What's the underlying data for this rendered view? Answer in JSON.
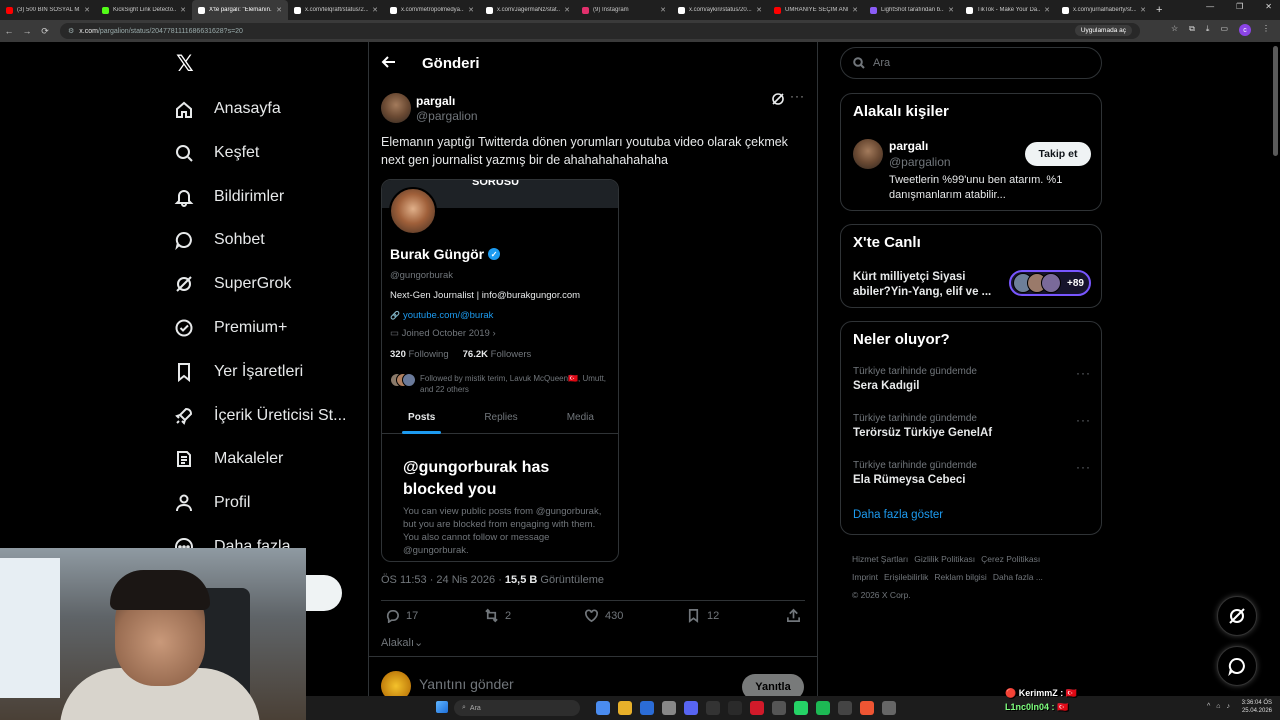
{
  "browser": {
    "tabs": [
      {
        "title": "(3) 500 BİN SOSYAL M...",
        "color": "#ff0000",
        "active": false
      },
      {
        "title": "KickSight Link Detecto...",
        "color": "#53fc18",
        "active": false
      },
      {
        "title": "X'te pargalı: \"Elemanın...",
        "color": "#ffffff",
        "active": true
      },
      {
        "title": "x.com/telqraft/status/2...",
        "color": "#ffffff",
        "active": false
      },
      {
        "title": "x.com/metropolmedya...",
        "color": "#ffffff",
        "active": false
      },
      {
        "title": "x.com/JagermaNz/stat...",
        "color": "#ffffff",
        "active": false
      },
      {
        "title": "(9) Instagram",
        "color": "#e1306c",
        "active": false
      },
      {
        "title": "x.com/aykiri/status/20...",
        "color": "#ffffff",
        "active": false
      },
      {
        "title": "ÜMRANİYE SEÇİM ANK...",
        "color": "#ff0000",
        "active": false
      },
      {
        "title": "LightShot tarafından b...",
        "color": "#8a5cf6",
        "active": false
      },
      {
        "title": "TikTok - Make Your Da...",
        "color": "#ffffff",
        "active": false
      },
      {
        "title": "x.com/jurnalhaberty/st...",
        "color": "#ffffff",
        "active": false
      }
    ],
    "url_host": "x.com",
    "url_path": "/pargalion/status/2047781111686631628?s=20",
    "open_in_app": "Uygulamada aç"
  },
  "nav": {
    "logo": "𝕏",
    "items": [
      {
        "label": "Anasayfa",
        "icon": "home-icon"
      },
      {
        "label": "Keşfet",
        "icon": "search-icon"
      },
      {
        "label": "Bildirimler",
        "icon": "bell-icon"
      },
      {
        "label": "Sohbet",
        "icon": "chat-icon"
      },
      {
        "label": "SuperGrok",
        "icon": "grok-icon"
      },
      {
        "label": "Premium+",
        "icon": "verified-icon"
      },
      {
        "label": "Yer İşaretleri",
        "icon": "bookmark-icon"
      },
      {
        "label": "İçerik Üreticisi St...",
        "icon": "rocket-icon"
      },
      {
        "label": "Makaleler",
        "icon": "article-icon"
      },
      {
        "label": "Profil",
        "icon": "person-icon"
      },
      {
        "label": "Daha fazla",
        "icon": "more-circle-icon"
      }
    ]
  },
  "post": {
    "header_title": "Gönderi",
    "author_name": "pargalı",
    "author_handle": "@pargalion",
    "text": "Elemanın yaptığı Twitterda dönen yorumları youtuba video olarak çekmek next gen journalist yazmış bir de ahahahahahahaha",
    "meta_time": "ÖS 11:53 · 24 Nis 2026 · ",
    "meta_views": "15,5 B",
    "meta_views_label": " Görüntüleme",
    "counts": {
      "replies": "17",
      "reposts": "2",
      "likes": "430",
      "bookmarks": "12"
    },
    "relevant_label": "Alakalı",
    "reply_placeholder": "Yanıtını gönder",
    "reply_button": "Yanıtla"
  },
  "embedded": {
    "top_text": "SORUSU",
    "name": "Burak Güngör",
    "handle": "@gungorburak",
    "bio": "Next-Gen Journalist | info@burakgungor.com",
    "link": "youtube.com/@burak",
    "joined": "Joined October 2019",
    "following_count": "320",
    "following_label": " Following",
    "followers_count": "76.2K",
    "followers_label": " Followers",
    "followed_by": "Followed by mistik terim, Lavuk McQueen🇹🇷, Umutt, and 22 others",
    "tabs": [
      "Posts",
      "Replies",
      "Media"
    ],
    "blocked_title": "@gungorburak has blocked you",
    "blocked_body": "You can view public posts from @gungorburak, but you are blocked from engaging with them. You also cannot follow or message @gungorburak."
  },
  "right": {
    "search_placeholder": "Ara",
    "related_title": "Alakalı kişiler",
    "related_name": "pargalı",
    "related_handle": "@pargalion",
    "related_bio": "Tweetlerin %99'unu ben atarım. %1 danışmanlarım atabilir...",
    "follow_label": "Takip et",
    "live_title": "X'te Canlı",
    "live_text": "Kürt milliyetçi Siyasi abiler?Yin-Yang, elif ve ...",
    "live_count": "+89",
    "trends_title": "Neler oluyor?",
    "trends": [
      {
        "meta": "Türkiye tarihinde gündemde",
        "name": "Sera Kadıgil"
      },
      {
        "meta": "Türkiye tarihinde gündemde",
        "name": "Terörsüz Türkiye GenelAf"
      },
      {
        "meta": "Türkiye tarihinde gündemde",
        "name": "Ela Rümeysa Cebeci"
      }
    ],
    "show_more": "Daha fazla göster",
    "footer_links": [
      "Hizmet Şartları",
      "Gizlilik Politikası",
      "Çerez Politikası",
      "Imprint",
      "Erişilebilirlik",
      "Reklam bilgisi",
      "Daha fazla ..."
    ],
    "copyright": "© 2026 X Corp."
  },
  "taskbar": {
    "search": "Ara",
    "time": "3:36:04 ÖS",
    "date": "25.04.2026"
  },
  "chat_overlay": {
    "line1": "🔴 KerimmZ : 🇹🇷",
    "line2": "L1nc0ln04 : 🇹🇷"
  },
  "colors": {
    "accent": "#1d9bf0",
    "background": "#000000",
    "border": "#2f3336",
    "muted": "#71767b"
  }
}
